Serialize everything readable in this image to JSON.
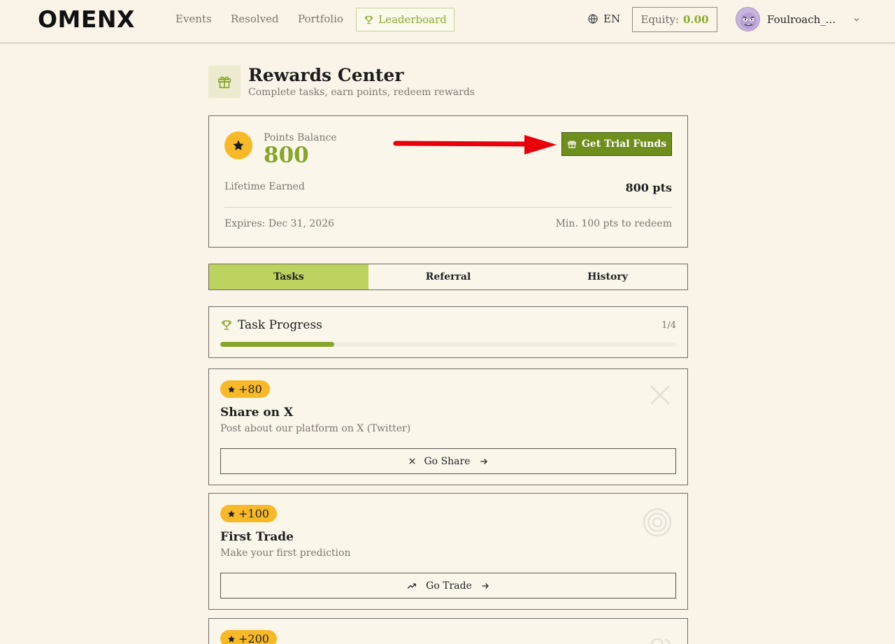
{
  "header": {
    "logo": "OMENX",
    "nav": [
      {
        "label": "Events"
      },
      {
        "label": "Resolved"
      },
      {
        "label": "Portfolio"
      }
    ],
    "leaderboard_label": "Leaderboard",
    "language": "EN",
    "equity_label": "Equity:",
    "equity_value": "0.00",
    "username": "Foulroach_..."
  },
  "page": {
    "title": "Rewards Center",
    "subtitle": "Complete tasks, earn points, redeem rewards"
  },
  "points": {
    "balance_label": "Points Balance",
    "balance_value": "800",
    "trial_button": "Get Trial Funds",
    "lifetime_label": "Lifetime Earned",
    "lifetime_value": "800 pts",
    "expires": "Expires: Dec 31, 2026",
    "min_redeem": "Min. 100 pts to redeem"
  },
  "tabs": [
    {
      "label": "Tasks",
      "active": true
    },
    {
      "label": "Referral",
      "active": false
    },
    {
      "label": "History",
      "active": false
    }
  ],
  "progress": {
    "title": "Task Progress",
    "count": "1/4",
    "fraction": 0.25
  },
  "tasks": [
    {
      "points": "+80",
      "title": "Share on X",
      "desc": "Post about our platform on X (Twitter)",
      "button": "Go Share",
      "icon": "x-icon"
    },
    {
      "points": "+100",
      "title": "First Trade",
      "desc": "Make your first prediction",
      "button": "Go Trade",
      "icon": "trend-icon"
    },
    {
      "points": "+200",
      "title": "",
      "desc": "",
      "button": "",
      "icon": "users-icon"
    }
  ],
  "colors": {
    "accent_green": "#86a52a",
    "tab_active": "#bcd35f",
    "badge_yellow": "#f7b928",
    "annotation_arrow": "#e8000b"
  }
}
